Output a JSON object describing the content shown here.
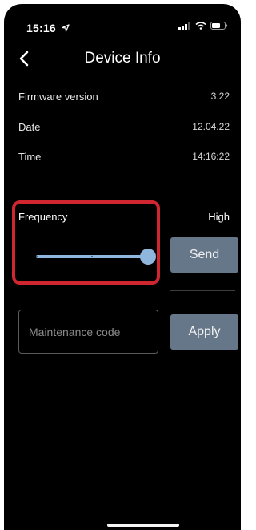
{
  "status_bar": {
    "time": "15:16",
    "location_icon": "location-arrow-icon"
  },
  "header": {
    "title": "Device Info"
  },
  "info_rows": [
    {
      "label": "Firmware version",
      "value": "3.22"
    },
    {
      "label": "Date",
      "value": "12.04.22"
    },
    {
      "label": "Time",
      "value": "14:16:22"
    }
  ],
  "frequency": {
    "label": "Frequency",
    "value": "High",
    "slider_level": 1.0,
    "send_label": "Send"
  },
  "maintenance": {
    "placeholder": "Maintenance code",
    "apply_label": "Apply"
  },
  "colors": {
    "accent": "#8fb7dd",
    "button": "#67778a",
    "highlight": "#d0262f"
  }
}
